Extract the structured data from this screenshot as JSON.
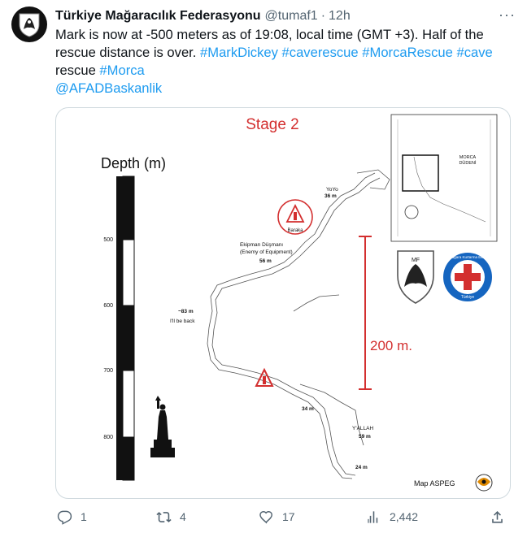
{
  "tweet": {
    "author_name": "Türkiye Mağaracılık Federasyonu",
    "handle": "@tumaf1",
    "separator": "·",
    "time": "12h",
    "text_part1": "Mark is now at -500 meters as of 19:08, local time (GMT +3). Half of the rescue distance is over. ",
    "tags": [
      "#MarkDickey",
      "#caverescue",
      "#MorcaRescue",
      "#cave"
    ],
    "text_part2": "rescue ",
    "tag_last": "#Morca",
    "mention": "@AFADBaskanlik"
  },
  "media": {
    "stage_title": "Stage 2",
    "depth_title": "Depth (m)",
    "ruler_ticks": [
      "500",
      "600",
      "700",
      "800"
    ],
    "labels": {
      "yoyo": "YoYo",
      "yoyo_depth": "36 m",
      "baraka": "Baraka",
      "enemy_tr": "Ekipman Düşmanı",
      "enemy_en": "(Enemy of Equipment)",
      "enemy_depth": "56 m",
      "illbeback_depth": "~83 m",
      "illbeback": "I'll be back",
      "depth_34": "34 m",
      "yallah": "Y'ALLAH",
      "yallah_depth": "59 m",
      "depth_24": "24 m",
      "distance": "200 m.",
      "map_credit": "Map ASPEG",
      "inset_title": "MORCA",
      "inset_subtitle": "DÜDENİ",
      "mf": "MF",
      "badge_top": "Mağara Kurtarma Ekibi",
      "badge_bottom": "Türkiye"
    },
    "colors": {
      "accent_red": "#d32f2f",
      "badge_blue": "#1565c0"
    }
  },
  "actions": {
    "reply_count": "1",
    "retweet_count": "4",
    "like_count": "17",
    "view_count": "2,442"
  }
}
